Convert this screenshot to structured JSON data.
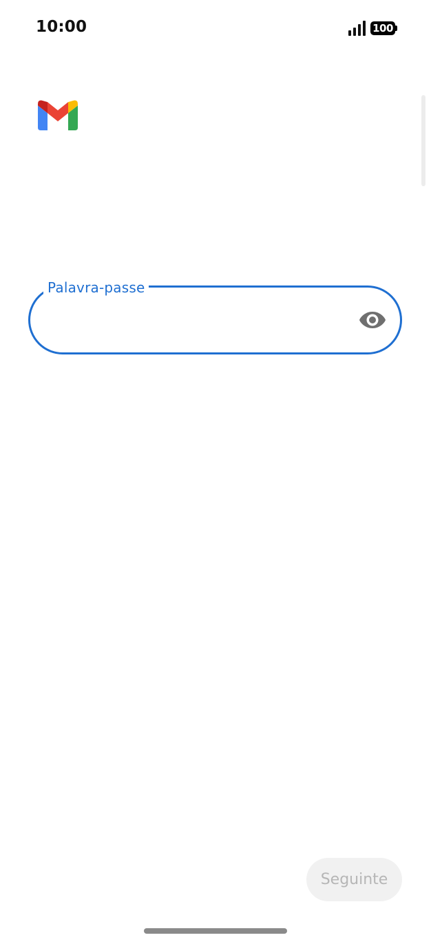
{
  "status_bar": {
    "time": "10:00",
    "battery_level": "100",
    "signal_icon": "cellular-signal-icon",
    "battery_icon": "battery-icon"
  },
  "app": {
    "logo_icon": "gmail-logo-icon",
    "colors": {
      "accent": "#1f6fd1",
      "logo_red": "#ea4335",
      "logo_blue": "#4285f4",
      "logo_green": "#34a853",
      "logo_yellow": "#fbbc04",
      "logo_dark_red": "#c5221f"
    }
  },
  "password_field": {
    "label": "Palavra-passe",
    "value": "",
    "toggle_icon": "eye-icon"
  },
  "actions": {
    "next_label": "Seguinte"
  }
}
